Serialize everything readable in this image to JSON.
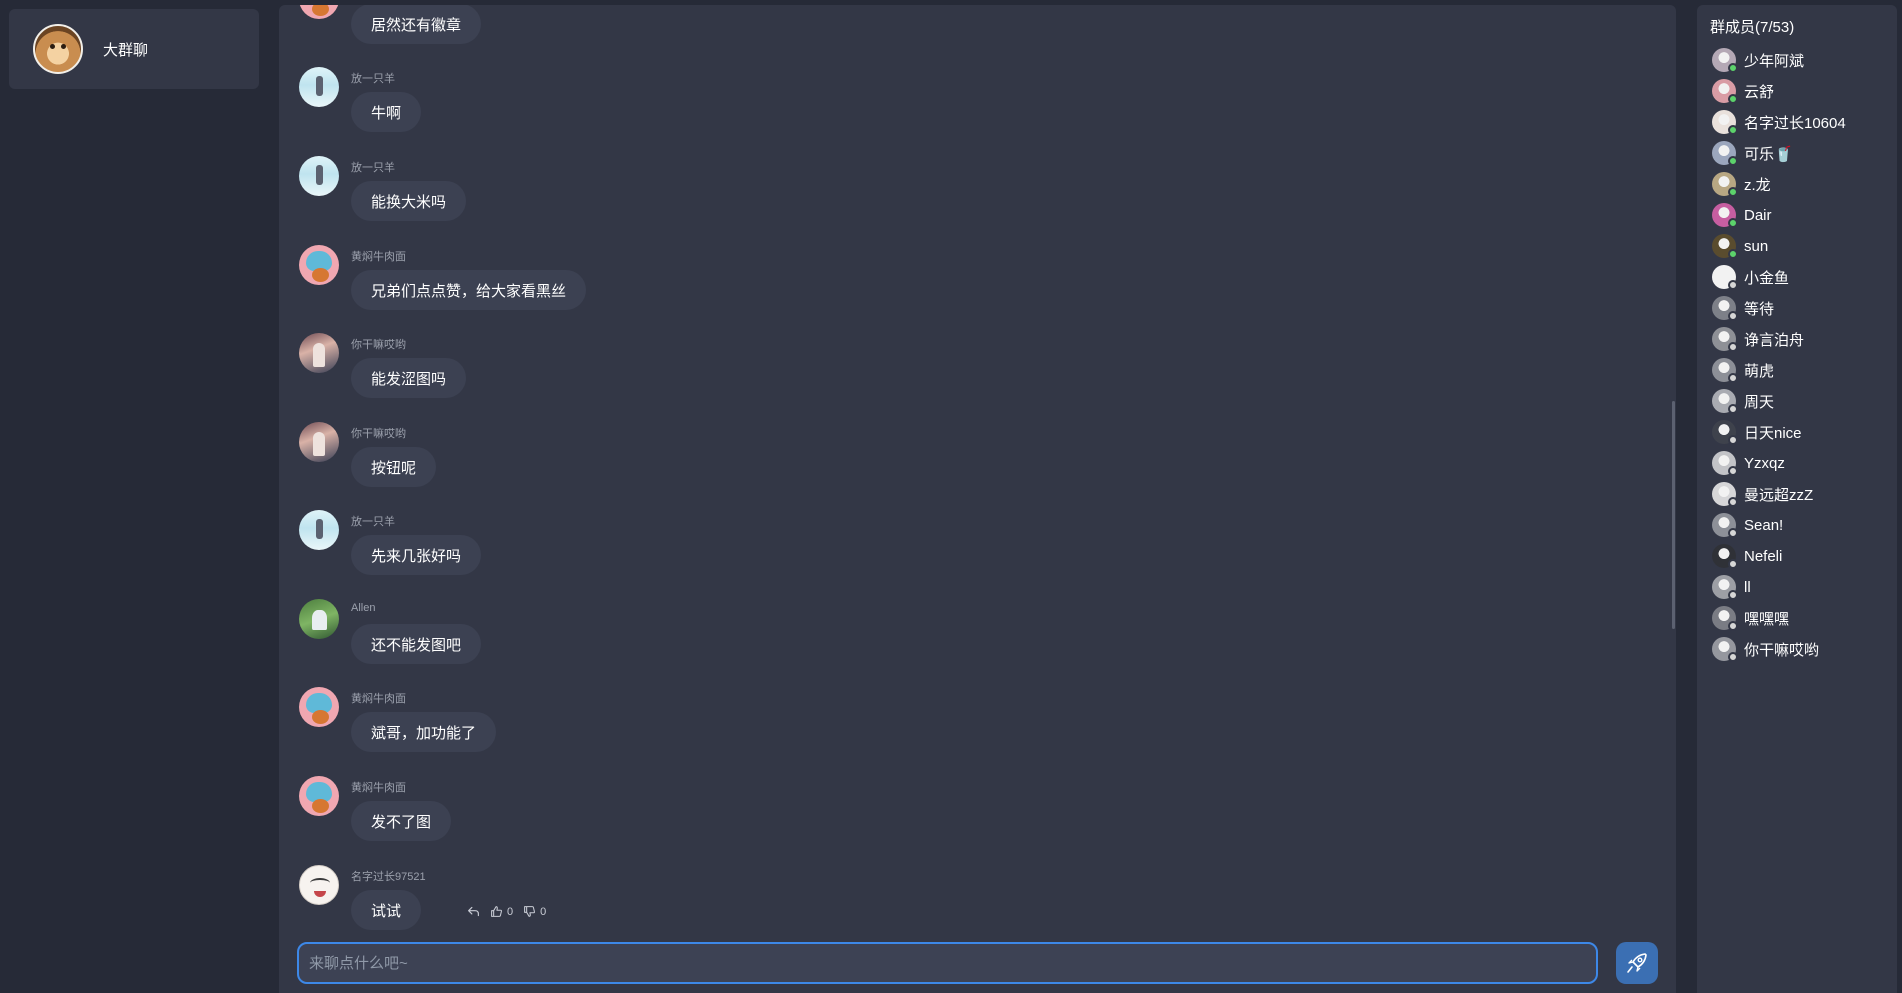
{
  "conversation": {
    "name": "大群聊"
  },
  "messages": [
    {
      "name": "",
      "text": "居然还有徽章",
      "avatar": "dino-avatar"
    },
    {
      "name": "放一只羊",
      "text": "牛啊",
      "avatar": "sheep-avatar"
    },
    {
      "name": "放一只羊",
      "text": "能换大米吗",
      "avatar": "sheep-avatar"
    },
    {
      "name": "黄焖牛肉面",
      "text": "兄弟们点点赞，给大家看黑丝",
      "avatar": "dino-avatar"
    },
    {
      "name": "你干嘛哎哟",
      "text": "能发涩图吗",
      "avatar": "photo-avatar"
    },
    {
      "name": "你干嘛哎哟",
      "text": "按钮呢",
      "avatar": "photo-avatar"
    },
    {
      "name": "放一只羊",
      "text": "先来几张好吗",
      "avatar": "sheep-avatar"
    },
    {
      "name": "Allen",
      "text": "还不能发图吧",
      "avatar": "allen-avatar"
    },
    {
      "name": "黄焖牛肉面",
      "text": "斌哥，加功能了",
      "avatar": "dino-avatar"
    },
    {
      "name": "黄焖牛肉面",
      "text": "发不了图",
      "avatar": "dino-avatar"
    },
    {
      "name": "名字过长97521",
      "text": "试试",
      "avatar": "face-avatar"
    }
  ],
  "last_message_actions": {
    "likes": "0",
    "dislikes": "0"
  },
  "input": {
    "placeholder": "来聊点什么吧~"
  },
  "members": {
    "title": "群成员(7/53)",
    "items": [
      {
        "name": "少年阿斌",
        "online": true,
        "color": "#b4a8b5"
      },
      {
        "name": "云舒",
        "online": true,
        "color": "#d99ca5"
      },
      {
        "name": "名字过长10604",
        "online": true,
        "color": "#e9e1dc"
      },
      {
        "name": "可乐🥤",
        "online": true,
        "color": "#9ba6bd"
      },
      {
        "name": "z.龙",
        "online": true,
        "color": "#b8a783"
      },
      {
        "name": "Dair",
        "online": true,
        "color": "#c75ea1"
      },
      {
        "name": "sun",
        "online": true,
        "color": "#5a4c2e"
      },
      {
        "name": "小金鱼",
        "online": false,
        "color": "#f2f2f2"
      },
      {
        "name": "等待",
        "online": false,
        "color": "#7d8088"
      },
      {
        "name": "诤言泊舟",
        "online": false,
        "color": "#8e9096"
      },
      {
        "name": "萌虎",
        "online": false,
        "color": "#8c8f97"
      },
      {
        "name": "周天",
        "online": false,
        "color": "#a9abb2"
      },
      {
        "name": "日天nice",
        "online": false,
        "color": "#3e424c"
      },
      {
        "name": "Yzxqz",
        "online": false,
        "color": "#c2c3c7"
      },
      {
        "name": "曼远超zzZ",
        "online": false,
        "color": "#d6d6d8"
      },
      {
        "name": "Sean!",
        "online": false,
        "color": "#8d9098"
      },
      {
        "name": "Nefeli",
        "online": false,
        "color": "#2f3137"
      },
      {
        "name": "ll",
        "online": false,
        "color": "#9d9fa5"
      },
      {
        "name": "嘿嘿嘿",
        "online": false,
        "color": "#7a7c84"
      },
      {
        "name": "你干嘛哎哟",
        "online": false,
        "color": "#95979e"
      }
    ]
  },
  "colors": {
    "accent": "#3d88e8",
    "online": "#5cd26b",
    "offline": "#d6d6d6"
  }
}
